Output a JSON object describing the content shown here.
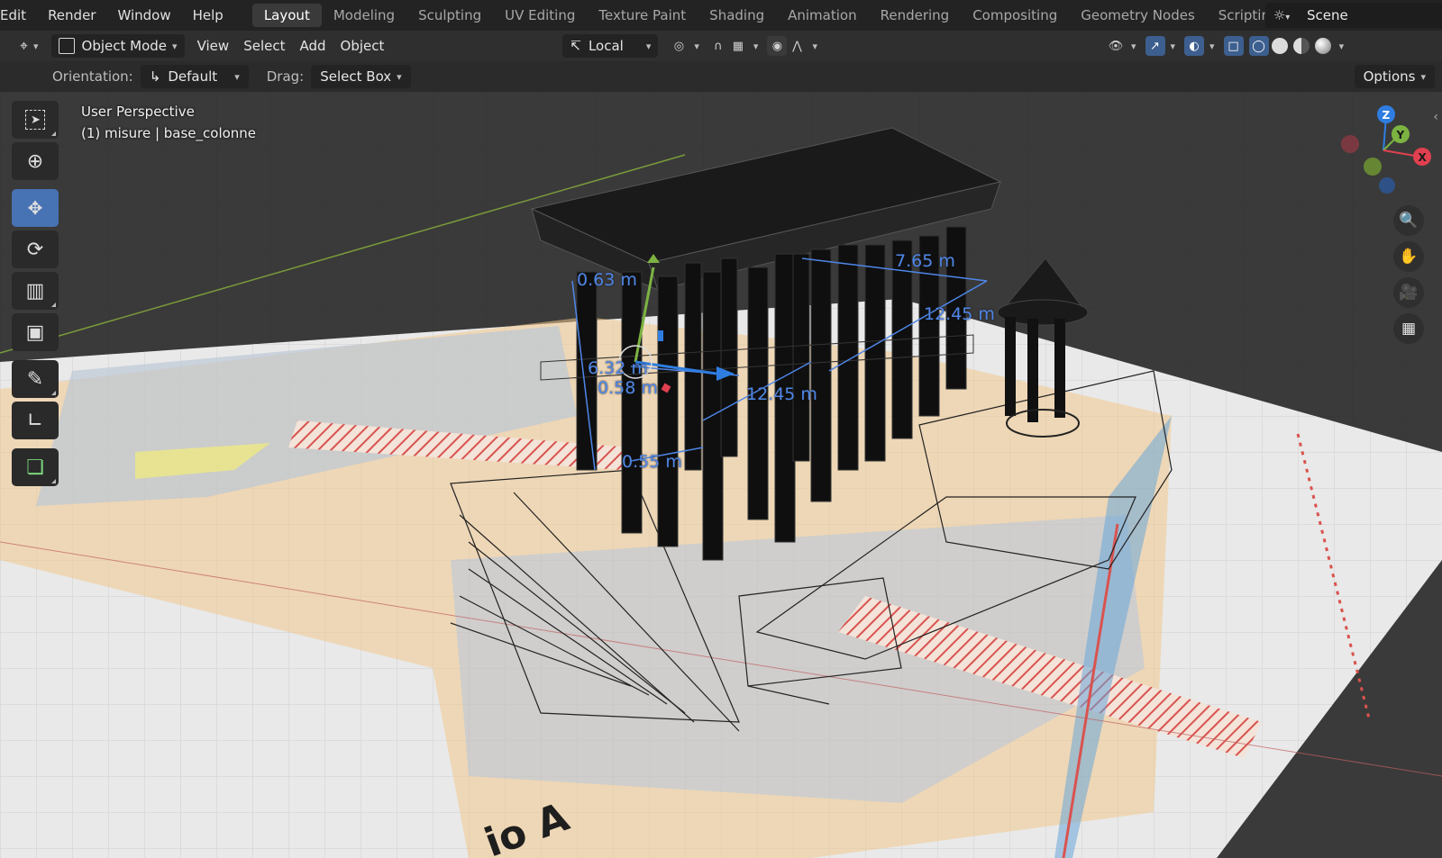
{
  "menu": {
    "items": [
      "Edit",
      "Render",
      "Window",
      "Help"
    ]
  },
  "workspaces": {
    "tabs": [
      "Layout",
      "Modeling",
      "Sculpting",
      "UV Editing",
      "Texture Paint",
      "Shading",
      "Animation",
      "Rendering",
      "Compositing",
      "Geometry Nodes",
      "Scripting"
    ],
    "active": "Layout",
    "add_label": "+"
  },
  "scene": {
    "name": "Scene",
    "icon": "scene-icon"
  },
  "header": {
    "editor_type_icon": "view3d-icon",
    "mode": "Object Mode",
    "menus": [
      "View",
      "Select",
      "Add",
      "Object"
    ],
    "transform_orientation": "Local",
    "icons": [
      "pivot-icon",
      "snap-icon",
      "snap-increment-icon",
      "proportional-edit-icon",
      "falloff-icon",
      "visibility-icon",
      "gizmo-icon",
      "overlay-icon",
      "xray-icon",
      "wireframe-shading-icon",
      "solid-shading-icon",
      "material-shading-icon",
      "rendered-shading-icon"
    ]
  },
  "tool_settings": {
    "orientation_label": "Orientation:",
    "orientation_value": "Default",
    "drag_label": "Drag:",
    "drag_value": "Select Box",
    "options_label": "Options"
  },
  "toolbar": {
    "tools": [
      {
        "name": "select-box-tool",
        "icon": "select-box-icon",
        "active": false
      },
      {
        "name": "cursor-tool",
        "icon": "cursor-icon",
        "active": false
      },
      {
        "name": "move-tool",
        "icon": "move-icon",
        "active": true
      },
      {
        "name": "rotate-tool",
        "icon": "rotate-icon",
        "active": false
      },
      {
        "name": "scale-tool",
        "icon": "scale-icon",
        "active": false
      },
      {
        "name": "transform-tool",
        "icon": "transform-icon",
        "active": false
      },
      {
        "name": "annotate-tool",
        "icon": "annotate-icon",
        "active": false
      },
      {
        "name": "measure-tool",
        "icon": "measure-icon",
        "active": false
      },
      {
        "name": "add-cube-tool",
        "icon": "add-cube-icon",
        "active": false
      }
    ]
  },
  "viewport": {
    "view_name": "User Perspective",
    "object_info": "(1) misure | base_colonne",
    "measurements": [
      "0.63 m",
      "7.65 m",
      "12.45 m",
      "6.32 m",
      "0.58 m",
      "12.45 m",
      "0.55 m"
    ],
    "floor_text": "io A"
  },
  "navigation": {
    "axes": [
      "X",
      "Y",
      "Z"
    ],
    "buttons": [
      "zoom-icon",
      "pan-hand-icon",
      "camera-icon",
      "perspective-grid-icon"
    ]
  },
  "colors": {
    "accent_blue": "#4772b3",
    "measure_blue": "#4f86e8",
    "axis_x": "#e0404f",
    "axis_y": "#7cb341",
    "axis_z": "#2f7de0",
    "floor": "#e8e8e8",
    "plan_orange": "#f2c98c",
    "plan_blue": "#6f9fd6",
    "hatch_red": "#d9534f"
  }
}
